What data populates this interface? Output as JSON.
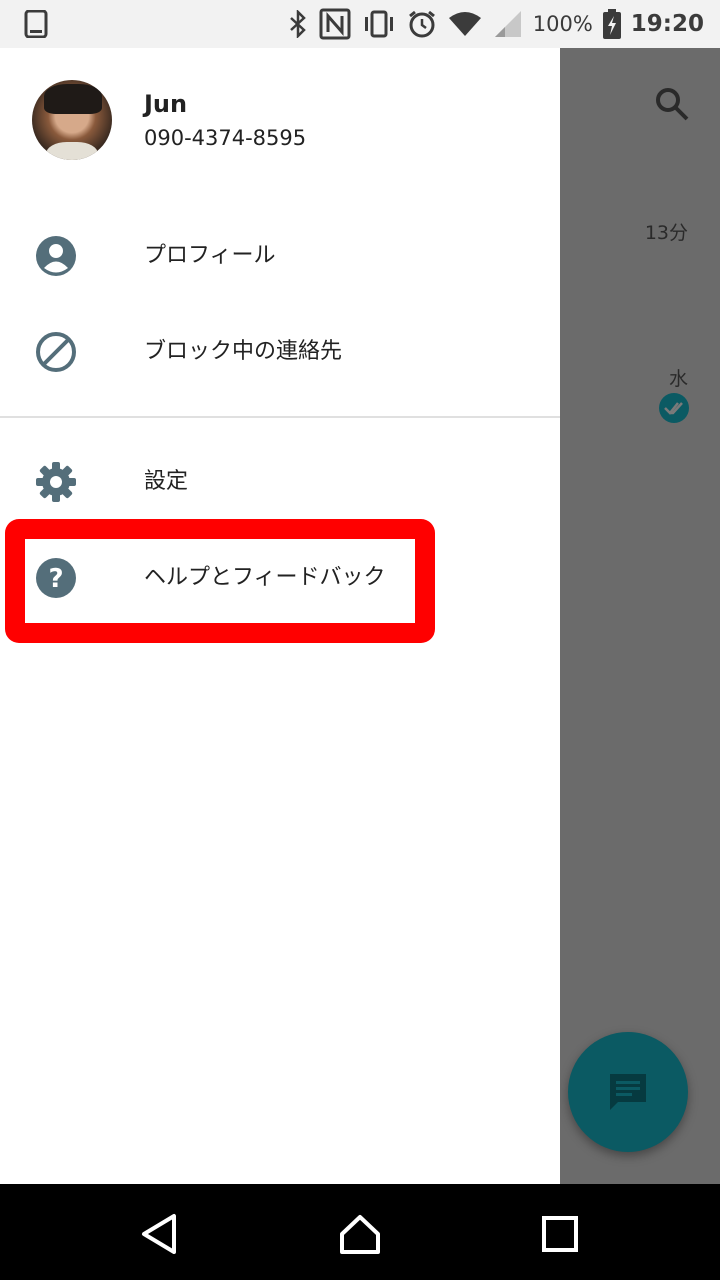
{
  "status_bar": {
    "battery": "100%",
    "time": "19:20",
    "icons": [
      "phone-icon",
      "bluetooth-icon",
      "nfc-icon",
      "vibrate-icon",
      "alarm-icon",
      "wifi-icon",
      "signal-icon",
      "battery-charging-icon"
    ]
  },
  "drawer": {
    "user": {
      "name": "Jun",
      "phone": "090-4374-8595"
    },
    "menu": [
      {
        "label": "プロフィール",
        "icon": "account-circle-icon"
      },
      {
        "label": "ブロック中の連絡先",
        "icon": "block-icon"
      },
      {
        "label": "設定",
        "icon": "settings-gear-icon"
      },
      {
        "label": "ヘルプとフィードバック",
        "icon": "help-circle-icon"
      }
    ]
  },
  "background": {
    "time_1": "13分",
    "time_2": "水"
  },
  "colors": {
    "accent": "#0b5a63",
    "highlight": "#ff0000",
    "icon": "#546e7a"
  }
}
